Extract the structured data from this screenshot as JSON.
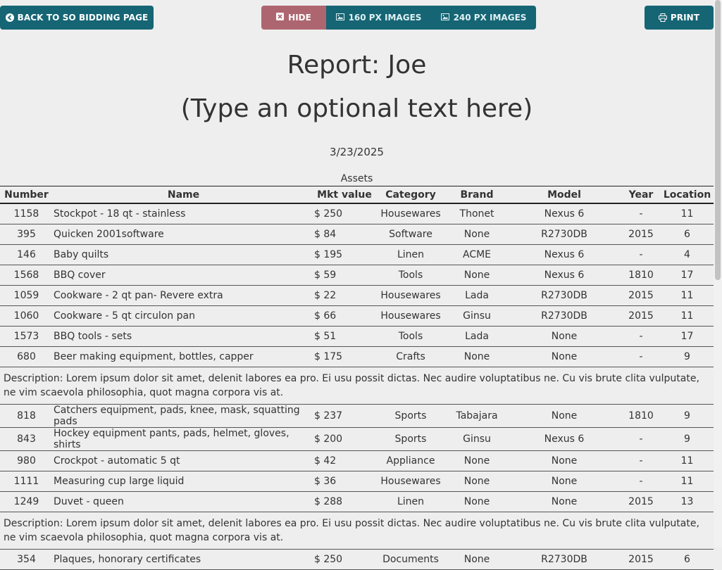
{
  "toolbar": {
    "back_label": "BACK TO SO BIDDING PAGE",
    "hide_label": "HIDE",
    "img160_label": "160 PX IMAGES",
    "img240_label": "240 PX IMAGES",
    "print_label": "PRINT"
  },
  "report": {
    "title": "Report: Joe",
    "subtitle": "(Type an optional text here)",
    "date": "3/23/2025",
    "caption": "Assets"
  },
  "table": {
    "headers": [
      "Number",
      "Name",
      "Mkt value",
      "Category",
      "Brand",
      "Model",
      "Year",
      "Location"
    ],
    "rows": [
      {
        "number": "1158",
        "name": "Stockpot - 18 qt - stainless",
        "mkt": "$ 250",
        "category": "Housewares",
        "brand": "Thonet",
        "model": "Nexus 6",
        "year": "-",
        "location": "11"
      },
      {
        "number": "395",
        "name": "Quicken 2001software",
        "mkt": "$ 84",
        "category": "Software",
        "brand": "None",
        "model": "R2730DB",
        "year": "2015",
        "location": "6"
      },
      {
        "number": "146",
        "name": "Baby quilts",
        "mkt": "$ 195",
        "category": "Linen",
        "brand": "ACME",
        "model": "Nexus 6",
        "year": "-",
        "location": "4"
      },
      {
        "number": "1568",
        "name": "BBQ cover",
        "mkt": "$ 59",
        "category": "Tools",
        "brand": "None",
        "model": "Nexus 6",
        "year": "1810",
        "location": "17"
      },
      {
        "number": "1059",
        "name": "Cookware - 2 qt pan- Revere extra",
        "mkt": "$ 22",
        "category": "Housewares",
        "brand": "Lada",
        "model": "R2730DB",
        "year": "2015",
        "location": "11"
      },
      {
        "number": "1060",
        "name": "Cookware - 5 qt circulon pan",
        "mkt": "$ 66",
        "category": "Housewares",
        "brand": "Ginsu",
        "model": "R2730DB",
        "year": "2015",
        "location": "11"
      },
      {
        "number": "1573",
        "name": "BBQ tools - sets",
        "mkt": "$ 51",
        "category": "Tools",
        "brand": "Lada",
        "model": "None",
        "year": "-",
        "location": "17"
      },
      {
        "number": "680",
        "name": "Beer making equipment, bottles, capper",
        "mkt": "$ 175",
        "category": "Crafts",
        "brand": "None",
        "model": "None",
        "year": "-",
        "location": "9",
        "description": "Description: Lorem ipsum dolor sit amet, delenit labores ea pro. Ei usu possit dictas. Nec audire voluptatibus ne. Cu vis brute clita vulputate, ne vim scaevola philosophia, quot magna corpora vis at."
      },
      {
        "number": "818",
        "name": "Catchers equipment, pads, knee, mask, squatting pads",
        "mkt": "$ 237",
        "category": "Sports",
        "brand": "Tabajara",
        "model": "None",
        "year": "1810",
        "location": "9"
      },
      {
        "number": "843",
        "name": "Hockey equipment pants, pads, helmet, gloves, shirts",
        "mkt": "$ 200",
        "category": "Sports",
        "brand": "Ginsu",
        "model": "Nexus 6",
        "year": "-",
        "location": "9"
      },
      {
        "number": "980",
        "name": "Crockpot - automatic 5 qt",
        "mkt": "$ 42",
        "category": "Appliance",
        "brand": "None",
        "model": "None",
        "year": "-",
        "location": "11"
      },
      {
        "number": "1111",
        "name": "Measuring cup large liquid",
        "mkt": "$ 36",
        "category": "Housewares",
        "brand": "None",
        "model": "None",
        "year": "-",
        "location": "11"
      },
      {
        "number": "1249",
        "name": "Duvet - queen",
        "mkt": "$ 288",
        "category": "Linen",
        "brand": "None",
        "model": "None",
        "year": "2015",
        "location": "13",
        "description": "Description: Lorem ipsum dolor sit amet, delenit labores ea pro. Ei usu possit dictas. Nec audire voluptatibus ne. Cu vis brute clita vulputate, ne vim scaevola philosophia, quot magna corpora vis at."
      },
      {
        "number": "354",
        "name": "Plaques, honorary certificates",
        "mkt": "$ 250",
        "category": "Documents",
        "brand": "None",
        "model": "R2730DB",
        "year": "2015",
        "location": "6"
      }
    ]
  }
}
